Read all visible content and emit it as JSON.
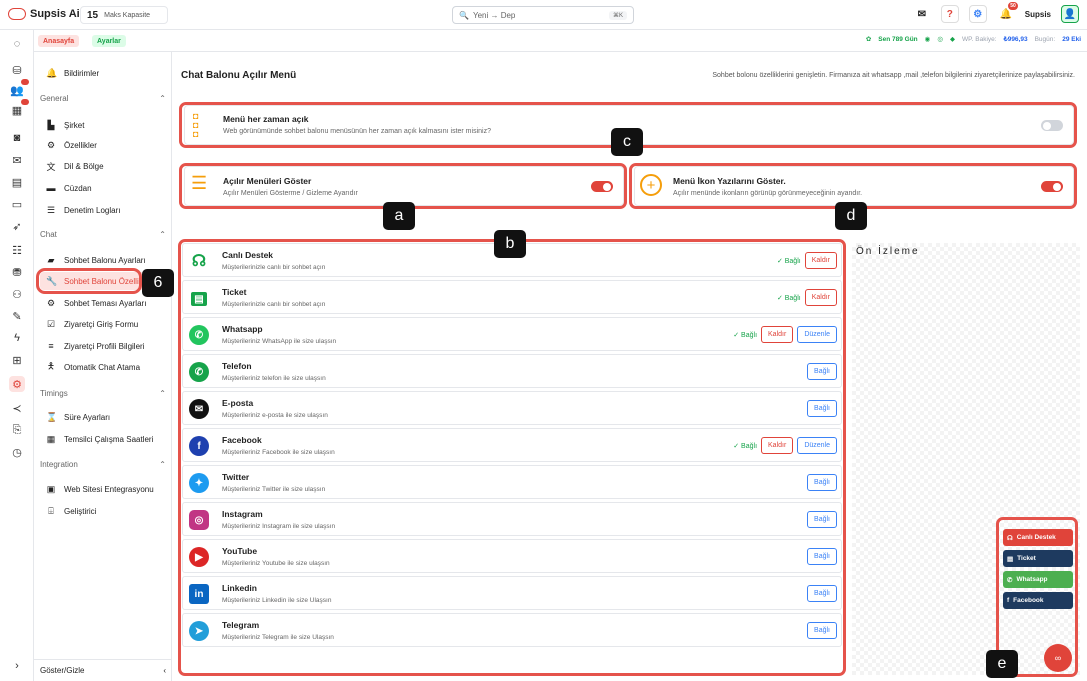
{
  "topbar": {
    "brand": "Supsis Ai",
    "cap_num": "15",
    "cap_label": "Maks Kapasite",
    "search_placeholder": "Yeni → Dep",
    "search_kbd": "⌘K",
    "user": "Supsis",
    "notif_count": "50"
  },
  "subbar": {
    "crumb_home": "Anasayfa",
    "crumb_settings": "Ayarlar",
    "days": "Sen 789 Gün",
    "wp_label": "WP. Bakiye:",
    "wp_val": "₺996,93",
    "today_label": "Bugün:",
    "today_val": "29 Eki"
  },
  "sidebar": {
    "notifications": "Bildirimler",
    "general": "General",
    "items_general": [
      "Şirket",
      "Özellikler",
      "Dil & Bölge",
      "Cüzdan",
      "Denetim Logları"
    ],
    "chat": "Chat",
    "items_chat": [
      "Sohbet Balonu Ayarları",
      "Sohbet Balonu Özellikleri",
      "Sohbet Teması Ayarları",
      "Ziyaretçi Giriş Formu",
      "Ziyaretçi Profili Bilgileri",
      "Otomatik Chat Atama"
    ],
    "timings": "Timings",
    "items_timings": [
      "Süre Ayarları",
      "Temsilci Çalışma Saatleri"
    ],
    "integration": "Integration",
    "items_integration": [
      "Web Sitesi Entegrasyonu",
      "Geliştirici"
    ],
    "footer": "Göster/Gizle"
  },
  "main": {
    "title": "Chat Balonu Açılır Menü",
    "subtitle": "Sohbet bolonu özelliklerini genişletin. Firmanıza ait whatsapp ,mail ,telefon bilgilerini ziyaretçilerinize paylaşabilirsiniz."
  },
  "cards": {
    "always_open_title": "Menü her zaman açık",
    "always_open_desc": "Web görünümünde sohbet balonu menüsünün her zaman açık kalmasını ister misiniz?",
    "show_menus_title": "Açılır Menüleri Göster",
    "show_menus_desc": "Açılır Menüleri Gösterme / Gizleme Ayarıdır",
    "show_icon_text_title": "Menü İkon Yazılarını Göster.",
    "show_icon_text_desc": "Açılır menünde ikonların görünüp görünmeyeceğinin ayandır."
  },
  "channels": [
    {
      "name": "Canlı Destek",
      "desc": "Müşterilerinizle canlı bir sohbet açın",
      "status": "✓ Bağlı",
      "remove": "Kaldır",
      "edit": "",
      "connect": "",
      "color": "#16a34a"
    },
    {
      "name": "Ticket",
      "desc": "Müşterilerinizle canlı bir sohbet açın",
      "status": "✓ Bağlı",
      "remove": "Kaldır",
      "edit": "",
      "connect": "",
      "color": "#16a34a"
    },
    {
      "name": "Whatsapp",
      "desc": "Müşterileriniz WhatsApp ile size ulaşsın",
      "status": "✓ Bağlı",
      "remove": "Kaldır",
      "edit": "Düzenle",
      "connect": "",
      "color": "#22c55e"
    },
    {
      "name": "Telefon",
      "desc": "Müşterileriniz telefon ile size ulaşsın",
      "status": "",
      "remove": "",
      "edit": "",
      "connect": "Bağlı",
      "color": "#16a34a"
    },
    {
      "name": "E-posta",
      "desc": "Müşterileriniz e-posta ile size ulaşsın",
      "status": "",
      "remove": "",
      "edit": "",
      "connect": "Bağlı",
      "color": "#111111"
    },
    {
      "name": "Facebook",
      "desc": "Müşterileriniz Facebook ile size ulaşsın",
      "status": "✓ Bağlı",
      "remove": "Kaldır",
      "edit": "Düzenle",
      "connect": "",
      "color": "#1e40af"
    },
    {
      "name": "Twitter",
      "desc": "Müşterileriniz Twitter ile size ulaşsın",
      "status": "",
      "remove": "",
      "edit": "",
      "connect": "Bağlı",
      "color": "#1d9bf0"
    },
    {
      "name": "Instagram",
      "desc": "Müşterileriniz Instagram ile size ulaşsın",
      "status": "",
      "remove": "",
      "edit": "",
      "connect": "Bağlı",
      "color": "#c13584"
    },
    {
      "name": "YouTube",
      "desc": "Müşterileriniz Youtube ile size ulaşsın",
      "status": "",
      "remove": "",
      "edit": "",
      "connect": "Bağlı",
      "color": "#dc2626"
    },
    {
      "name": "Linkedin",
      "desc": "Müşterileriniz Linkedin ile size Ulaşsın",
      "status": "",
      "remove": "",
      "edit": "",
      "connect": "Bağlı",
      "color": "#0a66c2"
    },
    {
      "name": "Telegram",
      "desc": "Müşterileriniz Telegram ile size Ulaşsın",
      "status": "",
      "remove": "",
      "edit": "",
      "connect": "Bağlı",
      "color": "#229ed9"
    }
  ],
  "preview": {
    "title": "Ön İzleme",
    "buttons": [
      "Canlı Destek",
      "Ticket",
      "Whatsapp",
      "Facebook"
    ]
  },
  "markers": {
    "a": "a",
    "b": "b",
    "c": "c",
    "d": "d",
    "e": "e",
    "six": "6"
  }
}
